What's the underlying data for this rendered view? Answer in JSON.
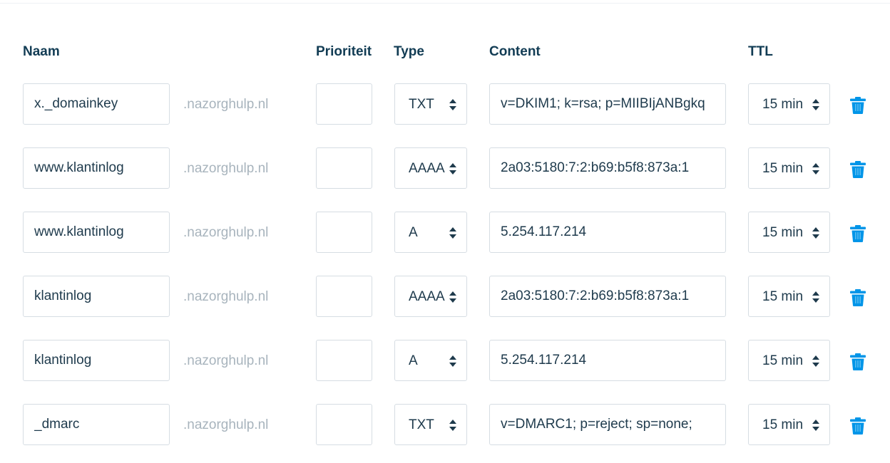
{
  "headers": {
    "name": "Naam",
    "priority": "Prioriteit",
    "type": "Type",
    "content": "Content",
    "ttl": "TTL"
  },
  "colors": {
    "accent": "#0095e8",
    "text": "#1e3a4c",
    "suffix": "#a8b4bd",
    "border": "#d6dde3"
  },
  "records": [
    {
      "name": "x._domainkey",
      "suffix": ".nazorghulp.nl",
      "priority": "",
      "type": "TXT",
      "content": "v=DKIM1; k=rsa; p=MIIBIjANBgkq",
      "ttl": "15 min"
    },
    {
      "name": "www.klantinlog",
      "suffix": ".nazorghulp.nl",
      "priority": "",
      "type": "AAAA",
      "content": "2a03:5180:7:2:b69:b5f8:873a:1",
      "ttl": "15 min"
    },
    {
      "name": "www.klantinlog",
      "suffix": ".nazorghulp.nl",
      "priority": "",
      "type": "A",
      "content": "5.254.117.214",
      "ttl": "15 min"
    },
    {
      "name": "klantinlog",
      "suffix": ".nazorghulp.nl",
      "priority": "",
      "type": "AAAA",
      "content": "2a03:5180:7:2:b69:b5f8:873a:1",
      "ttl": "15 min"
    },
    {
      "name": "klantinlog",
      "suffix": ".nazorghulp.nl",
      "priority": "",
      "type": "A",
      "content": "5.254.117.214",
      "ttl": "15 min"
    },
    {
      "name": "_dmarc",
      "suffix": ".nazorghulp.nl",
      "priority": "",
      "type": "TXT",
      "content": "v=DMARC1; p=reject; sp=none;",
      "ttl": "15 min"
    }
  ],
  "icons": {
    "delete": "trash-icon",
    "select_arrows": "sort-arrows-icon"
  }
}
